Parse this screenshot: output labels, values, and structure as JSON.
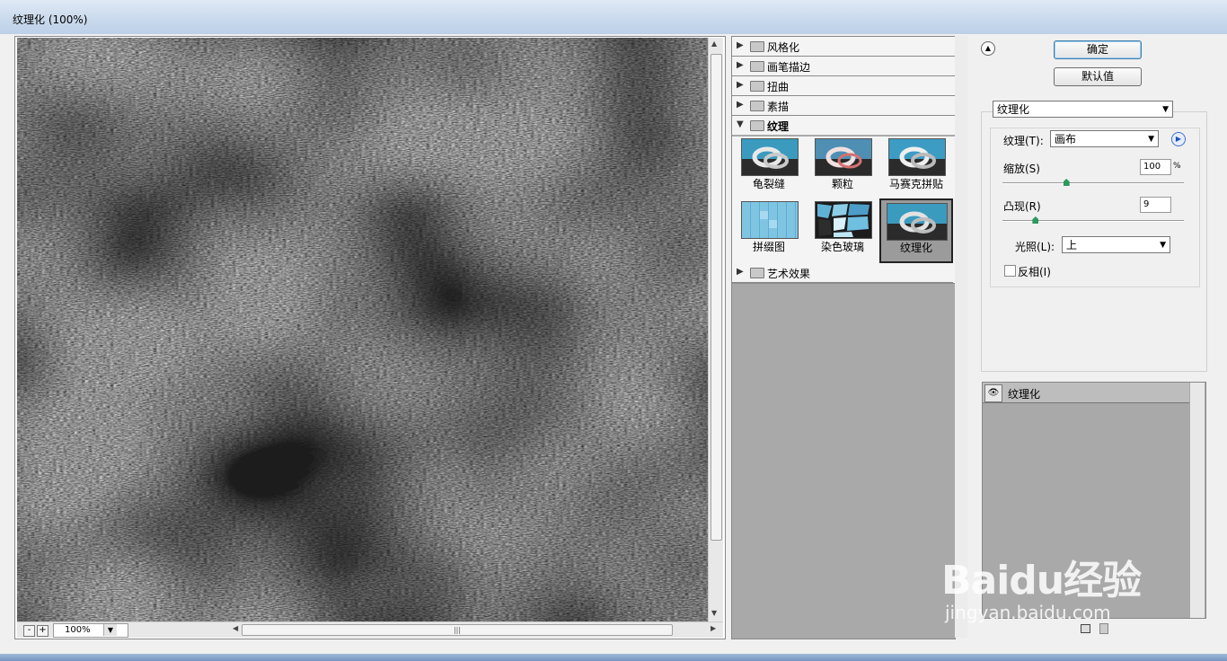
{
  "window": {
    "title": "纹理化 (100%)"
  },
  "preview": {
    "zoom": "100%",
    "zoom_out": "-",
    "zoom_in": "+"
  },
  "gallery": {
    "categories": [
      {
        "label": "风格化"
      },
      {
        "label": "画笔描边"
      },
      {
        "label": "扭曲"
      },
      {
        "label": "素描"
      },
      {
        "label": "纹理"
      },
      {
        "label": "艺术效果"
      }
    ],
    "texture_filters": [
      "龟裂缝",
      "颗粒",
      "马赛克拼贴",
      "拼缀图",
      "染色玻璃",
      "纹理化"
    ],
    "selected_filter": "纹理化"
  },
  "buttons": {
    "ok": "确定",
    "default": "默认值"
  },
  "settings": {
    "filter_select": "纹理化",
    "texture_label": "纹理(T):",
    "texture_value": "画布",
    "scale_label": "缩放(S)",
    "scale_value": "100",
    "scale_unit": "%",
    "scale_fraction": 0.35,
    "relief_label": "凸现(R)",
    "relief_value": "9",
    "relief_fraction": 0.18,
    "light_label": "光照(L):",
    "light_value": "上",
    "invert_label": "反相(I)",
    "invert_checked": false
  },
  "layers": {
    "items": [
      {
        "name": "纹理化",
        "visible": true
      }
    ]
  },
  "watermark": {
    "brand": "Baidu经验",
    "url": "jingyan.baidu.com"
  }
}
